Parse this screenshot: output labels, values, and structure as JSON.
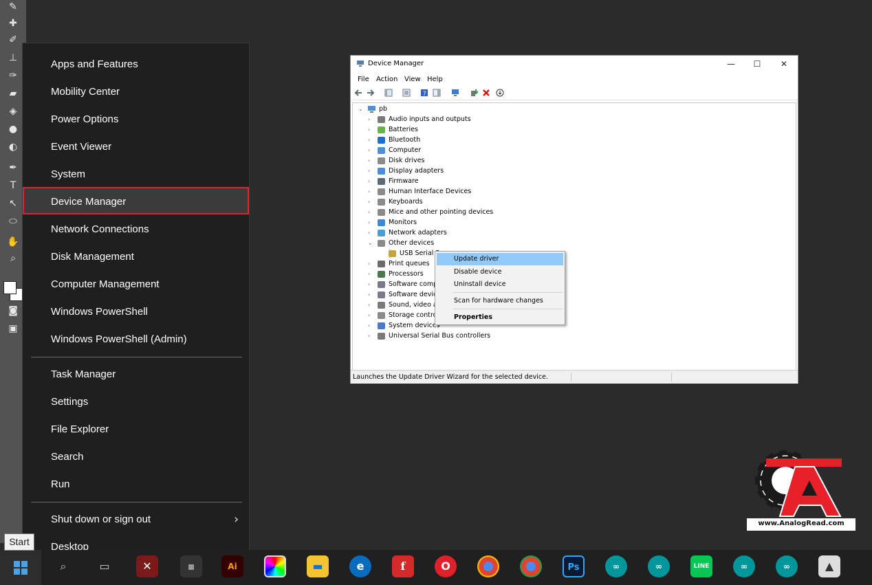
{
  "winx_menu": {
    "items": [
      {
        "label": "Apps and Features"
      },
      {
        "label": "Mobility Center"
      },
      {
        "label": "Power Options"
      },
      {
        "label": "Event Viewer"
      },
      {
        "label": "System"
      },
      {
        "label": "Device Manager",
        "selected": true
      },
      {
        "label": "Network Connections"
      },
      {
        "label": "Disk Management"
      },
      {
        "label": "Computer Management"
      },
      {
        "label": "Windows PowerShell"
      },
      {
        "label": "Windows PowerShell (Admin)"
      }
    ],
    "items2": [
      {
        "label": "Task Manager"
      },
      {
        "label": "Settings"
      },
      {
        "label": "File Explorer"
      },
      {
        "label": "Search"
      },
      {
        "label": "Run"
      }
    ],
    "items3": [
      {
        "label": "Shut down or sign out",
        "submenu": true
      },
      {
        "label": "Desktop"
      }
    ],
    "highlight_color": "#e8202a"
  },
  "start_tooltip": "Start",
  "device_manager": {
    "title": "Device Manager",
    "menu": [
      "File",
      "Action",
      "View",
      "Help"
    ],
    "root": "pb",
    "nodes": [
      {
        "label": "Audio inputs and outputs",
        "icon": "speaker-icon"
      },
      {
        "label": "Batteries",
        "icon": "battery-icon"
      },
      {
        "label": "Bluetooth",
        "icon": "bluetooth-icon"
      },
      {
        "label": "Computer",
        "icon": "computer-icon"
      },
      {
        "label": "Disk drives",
        "icon": "disk-icon"
      },
      {
        "label": "Display adapters",
        "icon": "display-icon"
      },
      {
        "label": "Firmware",
        "icon": "chip-icon"
      },
      {
        "label": "Human Interface Devices",
        "icon": "hid-icon"
      },
      {
        "label": "Keyboards",
        "icon": "keyboard-icon"
      },
      {
        "label": "Mice and other pointing devices",
        "icon": "mouse-icon"
      },
      {
        "label": "Monitors",
        "icon": "monitor-icon"
      },
      {
        "label": "Network adapters",
        "icon": "network-icon"
      },
      {
        "label": "Other devices",
        "icon": "other-devices-icon",
        "expanded": true
      },
      {
        "label": "USB Serial P",
        "icon": "warning-device-icon",
        "child": true,
        "selected": true
      },
      {
        "label": "Print queues",
        "icon": "printer-icon"
      },
      {
        "label": "Processors",
        "icon": "processor-icon"
      },
      {
        "label": "Software compo",
        "icon": "software-icon"
      },
      {
        "label": "Software device",
        "icon": "software-icon"
      },
      {
        "label": "Sound, video ar",
        "icon": "speaker-icon"
      },
      {
        "label": "Storage control",
        "icon": "storage-icon"
      },
      {
        "label": "System devices",
        "icon": "system-icon"
      },
      {
        "label": "Universal Serial Bus controllers",
        "icon": "usb-icon"
      }
    ],
    "status": "Launches the Update Driver Wizard for the selected device."
  },
  "context_menu": {
    "items": [
      {
        "label": "Update driver",
        "highlighted": true
      },
      {
        "label": "Disable device"
      },
      {
        "label": "Uninstall device"
      },
      {
        "label": "Scan for hardware changes"
      },
      {
        "label": "Properties",
        "bold": true
      }
    ]
  },
  "logo": {
    "text": "www.AnalogRead.com",
    "color": "#e8202a"
  }
}
